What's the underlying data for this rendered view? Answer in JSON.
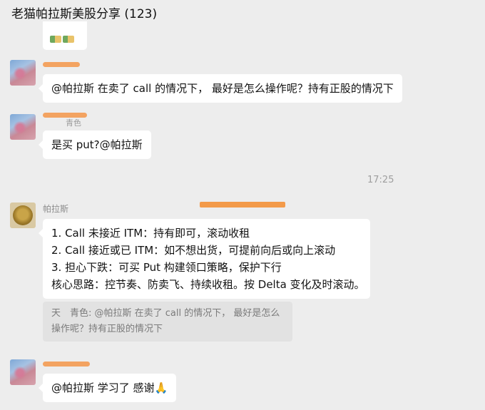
{
  "chat": {
    "title": "老猫帕拉斯美股分享 (123)"
  },
  "messages": {
    "m1": {
      "text": "@帕拉斯 在卖了 call 的情况下， 最好是怎么操作呢？持有正股的情况下"
    },
    "m2": {
      "name_fragment": "青色",
      "text": "是买 put?@帕拉斯"
    },
    "time": "17:25",
    "m3": {
      "sender": "帕拉斯",
      "lines": [
        "1. Call 未接近 ITM：持有即可，滚动收租",
        "2. Call 接近或已 ITM：如不想出货，可提前向后或向上滚动",
        "3. 担心下跌：可买 Put 构建领口策略，保护下行",
        "核心思路：控节奏、防卖飞、持续收租。按 Delta 变化及时滚动。"
      ],
      "quote_line1": "天　青色: @帕拉斯 在卖了 call 的情况下， 最好是怎么",
      "quote_line2": "操作呢？持有正股的情况下"
    },
    "m4": {
      "text": "@帕拉斯 学习了 感谢🙏"
    }
  },
  "colors": {
    "background": "#ededed",
    "bubble": "#ffffff",
    "redaction": "#f39a4a"
  },
  "icons": [
    "avatar-photo",
    "avatar-coin",
    "sticker-emoji",
    "pray-emoji"
  ]
}
